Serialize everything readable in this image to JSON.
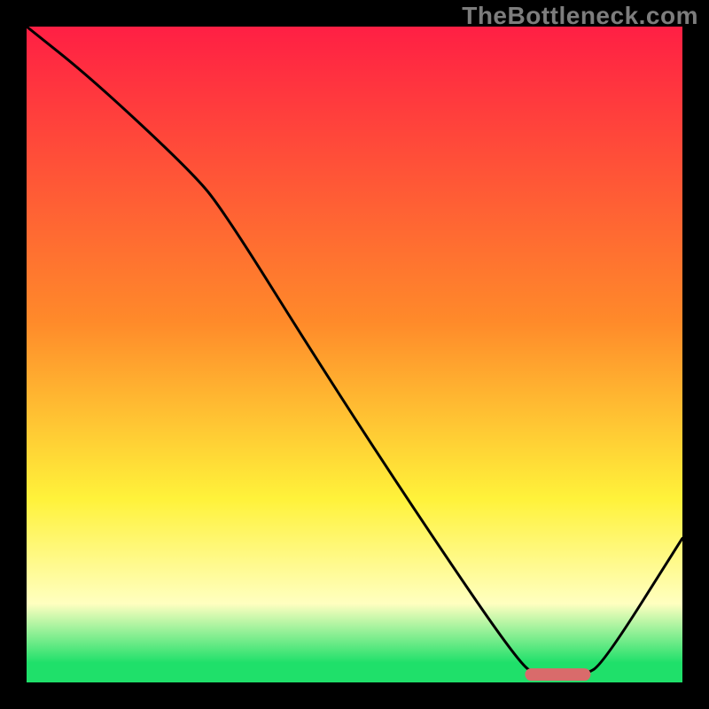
{
  "watermark": "TheBottleneck.com",
  "colors": {
    "frame_black": "#000000",
    "curve_black": "#000000",
    "marker_red": "#d96b6b",
    "grad_red": "#ff1f44",
    "grad_orange": "#ff8a2a",
    "grad_yellow": "#fff23a",
    "grad_paleyellow": "#ffffc0",
    "grad_green": "#1fe06a"
  },
  "chart_data": {
    "type": "line",
    "title": "",
    "xlabel": "",
    "ylabel": "",
    "xlim": [
      0,
      100
    ],
    "ylim": [
      0,
      100
    ],
    "axes_visible": false,
    "grid": false,
    "legend": false,
    "gradient_stops": [
      {
        "pct": 0,
        "color": "#ff1f44"
      },
      {
        "pct": 45,
        "color": "#ff8a2a"
      },
      {
        "pct": 72,
        "color": "#fff23a"
      },
      {
        "pct": 88,
        "color": "#ffffc0"
      },
      {
        "pct": 97,
        "color": "#1fe06a"
      },
      {
        "pct": 100,
        "color": "#1fe06a"
      }
    ],
    "series": [
      {
        "name": "bottleneck-curve",
        "x": [
          0,
          10,
          25,
          30,
          45,
          60,
          75,
          78,
          85,
          88,
          100
        ],
        "y": [
          100,
          92,
          78,
          72,
          48,
          25,
          3,
          1,
          1,
          3,
          22
        ]
      }
    ],
    "marker": {
      "name": "optimal-range",
      "x_start": 76,
      "x_end": 86,
      "y": 1.2,
      "color": "#d96b6b"
    }
  }
}
